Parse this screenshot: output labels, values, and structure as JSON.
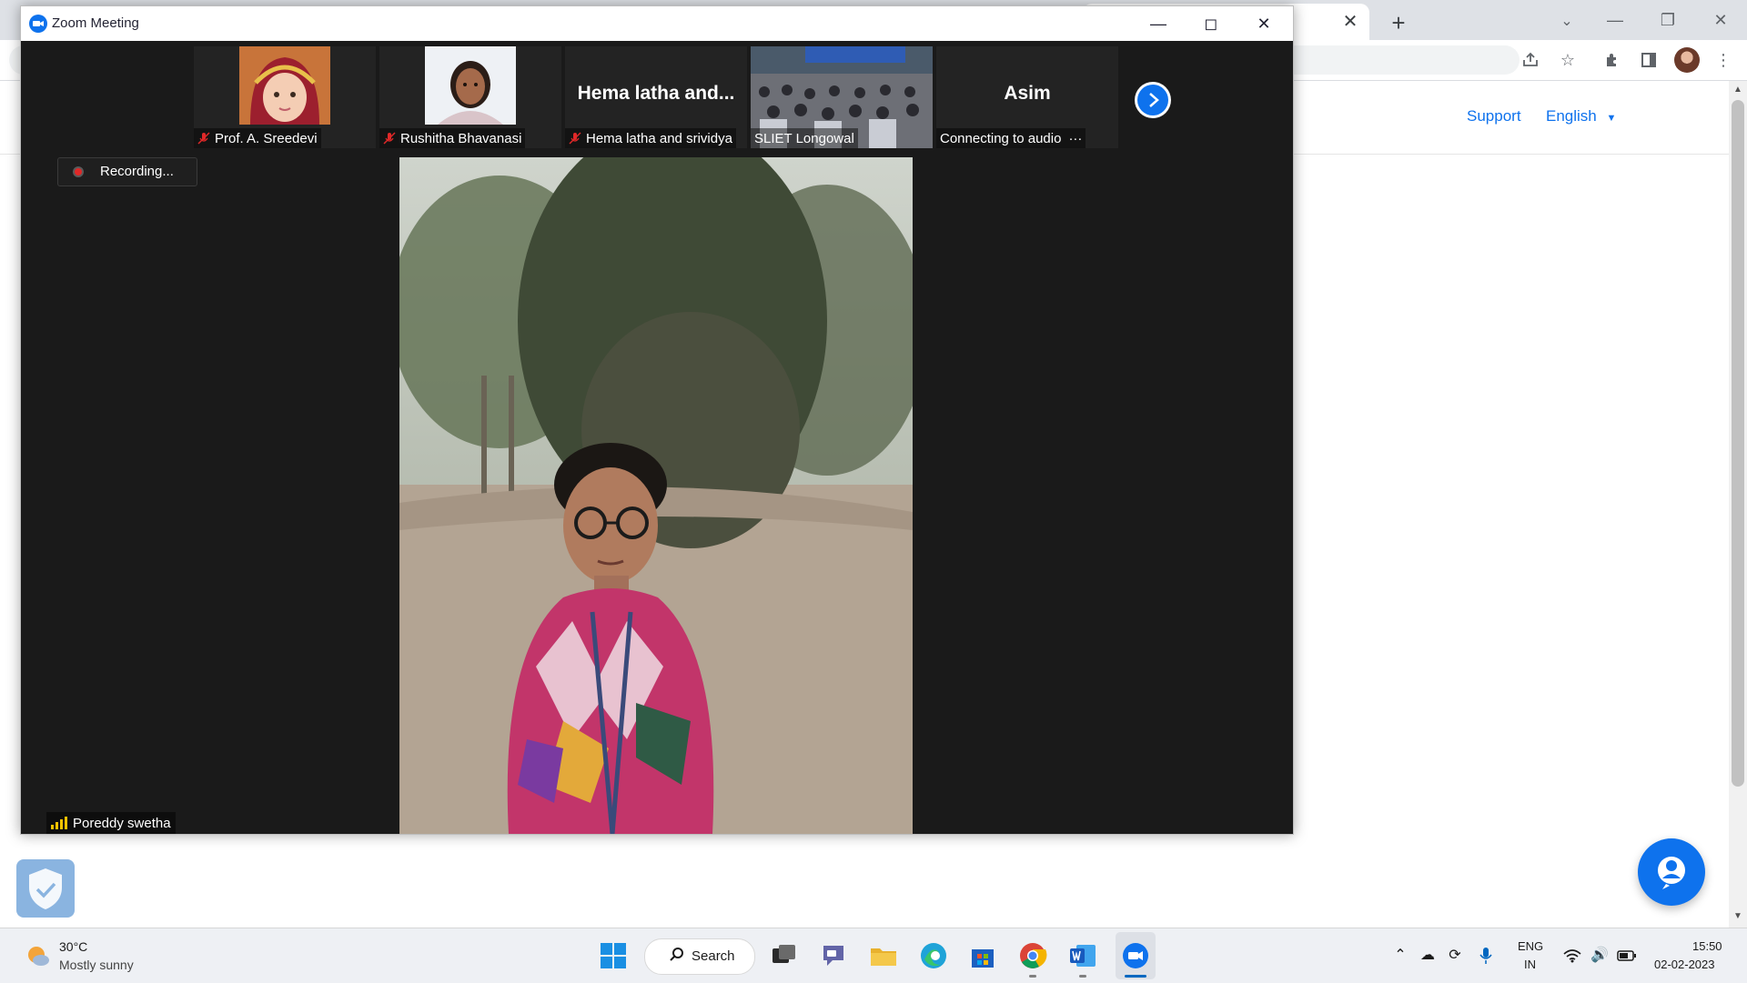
{
  "zoom": {
    "title": "Zoom Meeting",
    "recording": "Recording...",
    "active_speaker": "Poreddy swetha",
    "participants": [
      {
        "name": "Prof. A. Sreedevi",
        "muted": true
      },
      {
        "name": "Rushitha Bhavanasi",
        "muted": true
      },
      {
        "name": "Hema latha and srividya",
        "display": "Hema latha and...",
        "muted": true
      },
      {
        "name": "SLIET Longowal",
        "muted": false
      },
      {
        "name": "Asim",
        "status": "Connecting to audio",
        "more": "···"
      }
    ]
  },
  "browser": {
    "tab_close": "✕",
    "new_tab": "+",
    "support": "Support",
    "language": "English"
  },
  "taskbar": {
    "weather_temp": "30°C",
    "weather_desc": "Mostly sunny",
    "search_label": "Search",
    "lang_top": "ENG",
    "lang_bottom": "IN",
    "time": "15:50",
    "date": "02-02-2023"
  },
  "colors": {
    "zoom_blue": "#0e72ed",
    "meeting_bg": "#1a1a1a",
    "recording_red": "#e02828",
    "taskbar_bg": "#eef0f4"
  }
}
